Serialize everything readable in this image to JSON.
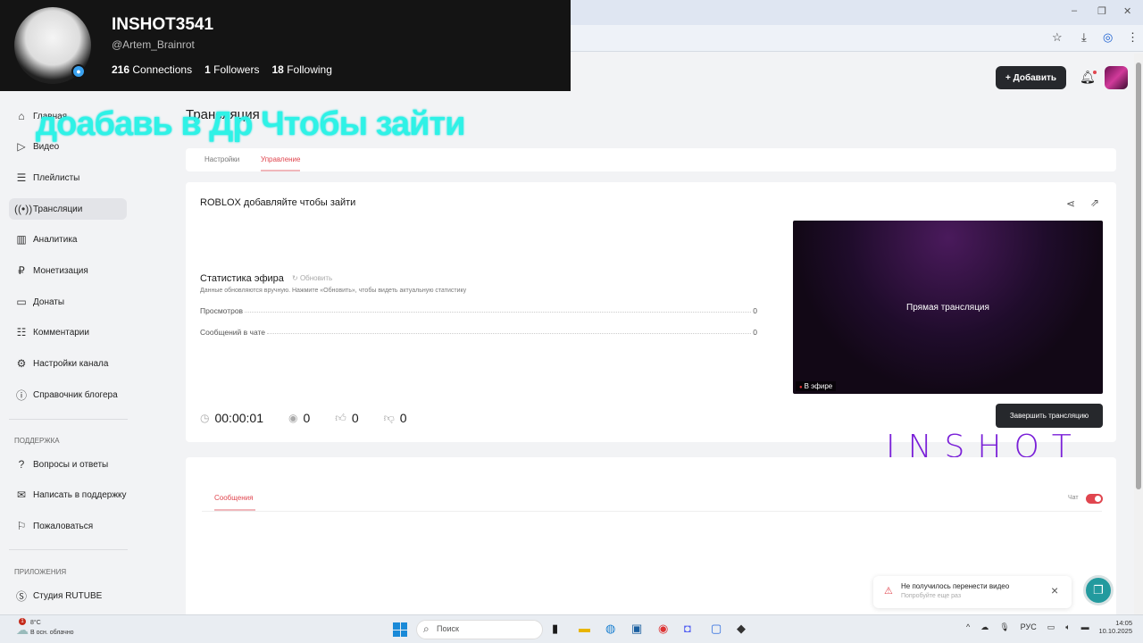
{
  "browser": {
    "icons": [
      "star-icon",
      "download-icon",
      "profile-icon",
      "menu-icon"
    ]
  },
  "profile": {
    "username": "INSHOT3541",
    "handle": "@Artem_Brainrot",
    "connections_count": "216",
    "connections_label": "Connections",
    "followers_count": "1",
    "followers_label": "Followers",
    "following_count": "18",
    "following_label": "Following"
  },
  "overlay_text": "доабавь в Др Чтобы зайти",
  "header": {
    "add_label": "Добавить"
  },
  "sidebar": {
    "items": [
      {
        "label": "Главная",
        "icon": "home-icon"
      },
      {
        "label": "Видео",
        "icon": "video-icon"
      },
      {
        "label": "Плейлисты",
        "icon": "playlist-icon"
      },
      {
        "label": "Трансляции",
        "icon": "broadcast-icon",
        "active": true
      },
      {
        "label": "Аналитика",
        "icon": "analytics-icon"
      },
      {
        "label": "Монетизация",
        "icon": "ruble-icon"
      },
      {
        "label": "Донаты",
        "icon": "wallet-icon"
      },
      {
        "label": "Комментарии",
        "icon": "comment-icon"
      },
      {
        "label": "Настройки канала",
        "icon": "gear-icon"
      },
      {
        "label": "Справочник блогера",
        "icon": "info-icon"
      }
    ],
    "support_heading": "ПОДДЕРЖКА",
    "support": [
      {
        "label": "Вопросы и ответы",
        "icon": "question-icon"
      },
      {
        "label": "Написать в поддержку",
        "icon": "mail-icon"
      },
      {
        "label": "Пожаловаться",
        "icon": "flag-icon"
      }
    ],
    "apps_heading": "ПРИЛОЖЕНИЯ",
    "apps": [
      {
        "label": "Студия RUTUBE",
        "icon": "studio-icon"
      }
    ]
  },
  "main": {
    "title": "Трансляция",
    "tabs": [
      {
        "label": "Настройки"
      },
      {
        "label": "Управление",
        "active": true
      }
    ],
    "stream_title": "ROBLOX добавляйте чтобы зайти",
    "stats_title": "Статистика эфира",
    "refresh_label": "Обновить",
    "stats_hint": "Данные обновляются вручную. Нажмите «Обновить», чтобы видеть актуальную статистику",
    "stats": [
      {
        "label": "Просмотров",
        "value": "0"
      },
      {
        "label": "Сообщений в чате",
        "value": "0"
      }
    ],
    "duration": "00:00:01",
    "viewers": "0",
    "likes": "0",
    "dislikes": "0",
    "preview_label": "Прямая трансляция",
    "live_badge": "В эфире",
    "end_button": "Завершить трансляцию",
    "watermark": "INSHOT",
    "chat_tab": "Сообщения",
    "chat_toggle_label": "Чат",
    "chat_enabled": true
  },
  "toast": {
    "title": "Не получилось перенести видео",
    "subtitle": "Попробуйте еще раз"
  },
  "taskbar": {
    "temperature": "8°C",
    "weather": "В осн. облачно",
    "weather_badge": "1",
    "search_placeholder": "Поиск",
    "language": "РУС",
    "time": "14:05",
    "date": "10.10.2025"
  },
  "colors": {
    "accent": "#e0464f",
    "overlay": "#2ef2e6",
    "watermark": "#7a20d8",
    "help": "#239a9e"
  }
}
